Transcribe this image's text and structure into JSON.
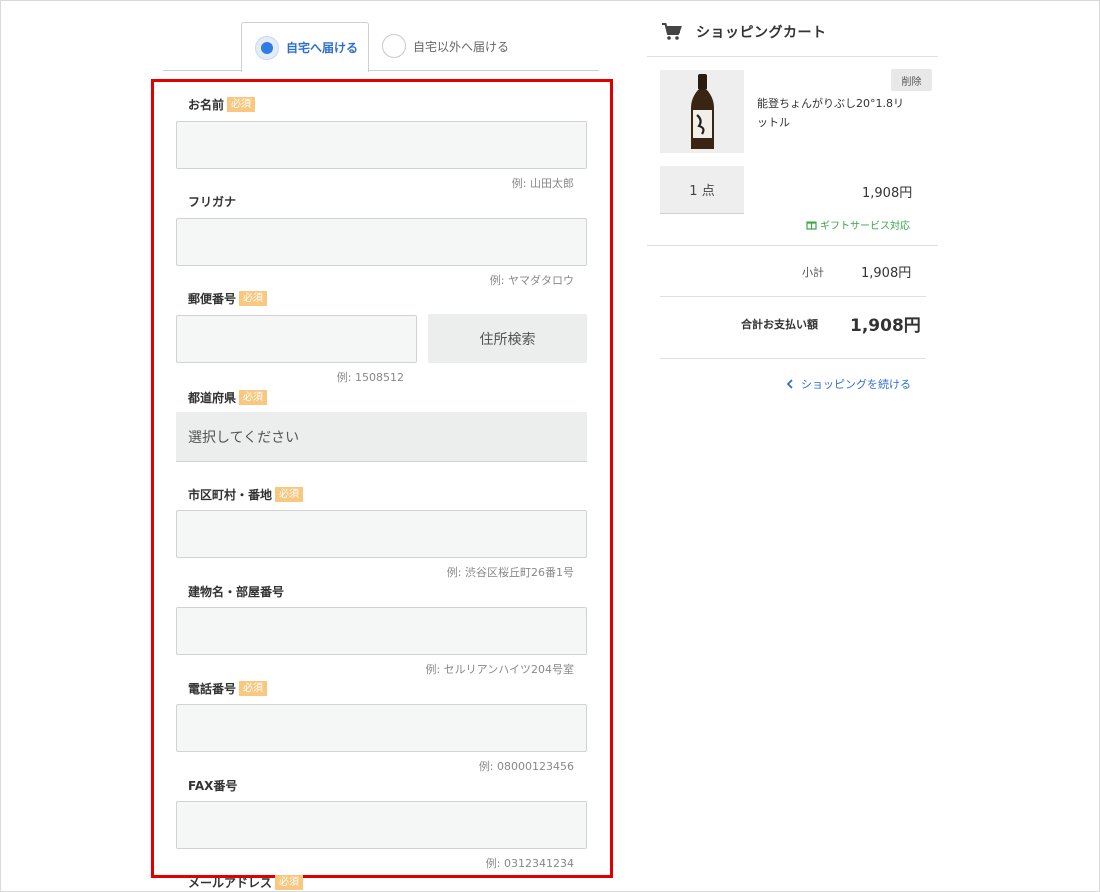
{
  "delivery_tabs": {
    "home": "自宅へ届ける",
    "other": "自宅以外へ届ける"
  },
  "form": {
    "required_badge": "必須",
    "name": {
      "label": "お名前",
      "hint": "例: 山田太郎"
    },
    "furigana": {
      "label": "フリガナ",
      "hint": "例: ヤマダタロウ"
    },
    "postal": {
      "label": "郵便番号",
      "hint": "例: 1508512",
      "search_button": "住所検索"
    },
    "prefecture": {
      "label": "都道府県",
      "selected": "選択してください"
    },
    "city": {
      "label": "市区町村・番地",
      "hint": "例: 渋谷区桜丘町26番1号"
    },
    "building": {
      "label": "建物名・部屋番号",
      "hint": "例: セルリアンハイツ204号室"
    },
    "phone": {
      "label": "電話番号",
      "hint": "例: 08000123456"
    },
    "fax": {
      "label": "FAX番号",
      "hint": "例: 0312341234"
    },
    "email": {
      "label": "メールアドレス"
    }
  },
  "cart": {
    "title": "ショッピングカート",
    "item": {
      "name": "能登ちょんがりぶし20°1.8リットル",
      "delete_label": "削除",
      "quantity": "1 点",
      "price": "1,908円",
      "gift": "ギフトサービス対応"
    },
    "subtotal_label": "小計",
    "subtotal_value": "1,908円",
    "total_label": "合計お支払い額",
    "total_value": "1,908円",
    "continue_label": "ショッピングを続ける"
  },
  "colors": {
    "accent": "#2f7de1",
    "required_badge": "#f8c881",
    "highlight_border": "#e00000",
    "gift_green": "#3aa64a"
  }
}
